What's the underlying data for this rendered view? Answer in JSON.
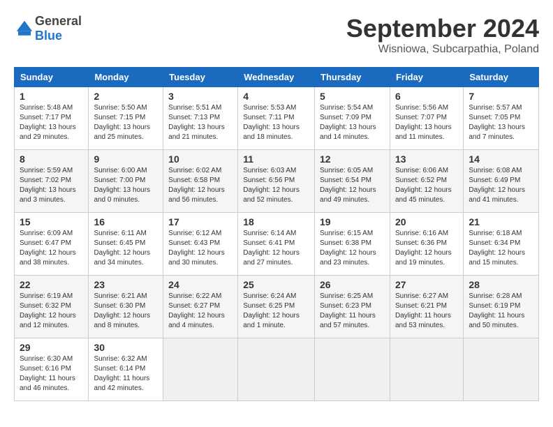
{
  "header": {
    "logo": {
      "general": "General",
      "blue": "Blue"
    },
    "title": "September 2024",
    "subtitle": "Wisniowa, Subcarpathia, Poland"
  },
  "calendar": {
    "columns": [
      "Sunday",
      "Monday",
      "Tuesday",
      "Wednesday",
      "Thursday",
      "Friday",
      "Saturday"
    ],
    "weeks": [
      [
        null,
        {
          "day": "2",
          "info": "Sunrise: 5:50 AM\nSunset: 7:17 PM\nDaylight: 13 hours\nand 25 minutes."
        },
        {
          "day": "3",
          "info": "Sunrise: 5:51 AM\nSunset: 7:13 PM\nDaylight: 13 hours\nand 21 minutes."
        },
        {
          "day": "4",
          "info": "Sunrise: 5:53 AM\nSunset: 7:11 PM\nDaylight: 13 hours\nand 18 minutes."
        },
        {
          "day": "5",
          "info": "Sunrise: 5:54 AM\nSunset: 7:09 PM\nDaylight: 13 hours\nand 14 minutes."
        },
        {
          "day": "6",
          "info": "Sunrise: 5:56 AM\nSunset: 7:07 PM\nDaylight: 13 hours\nand 11 minutes."
        },
        {
          "day": "7",
          "info": "Sunrise: 5:57 AM\nSunset: 7:05 PM\nDaylight: 13 hours\nand 7 minutes."
        }
      ],
      [
        {
          "day": "1",
          "info": "Sunrise: 5:48 AM\nSunset: 7:17 PM\nDaylight: 13 hours\nand 29 minutes."
        },
        {
          "day": "9",
          "info": "Sunrise: 6:00 AM\nSunset: 7:00 PM\nDaylight: 13 hours\nand 0 minutes."
        },
        {
          "day": "10",
          "info": "Sunrise: 6:02 AM\nSunset: 6:58 PM\nDaylight: 12 hours\nand 56 minutes."
        },
        {
          "day": "11",
          "info": "Sunrise: 6:03 AM\nSunset: 6:56 PM\nDaylight: 12 hours\nand 52 minutes."
        },
        {
          "day": "12",
          "info": "Sunrise: 6:05 AM\nSunset: 6:54 PM\nDaylight: 12 hours\nand 49 minutes."
        },
        {
          "day": "13",
          "info": "Sunrise: 6:06 AM\nSunset: 6:52 PM\nDaylight: 12 hours\nand 45 minutes."
        },
        {
          "day": "14",
          "info": "Sunrise: 6:08 AM\nSunset: 6:49 PM\nDaylight: 12 hours\nand 41 minutes."
        }
      ],
      [
        {
          "day": "8",
          "info": "Sunrise: 5:59 AM\nSunset: 7:02 PM\nDaylight: 13 hours\nand 3 minutes."
        },
        {
          "day": "16",
          "info": "Sunrise: 6:11 AM\nSunset: 6:45 PM\nDaylight: 12 hours\nand 34 minutes."
        },
        {
          "day": "17",
          "info": "Sunrise: 6:12 AM\nSunset: 6:43 PM\nDaylight: 12 hours\nand 30 minutes."
        },
        {
          "day": "18",
          "info": "Sunrise: 6:14 AM\nSunset: 6:41 PM\nDaylight: 12 hours\nand 27 minutes."
        },
        {
          "day": "19",
          "info": "Sunrise: 6:15 AM\nSunset: 6:38 PM\nDaylight: 12 hours\nand 23 minutes."
        },
        {
          "day": "20",
          "info": "Sunrise: 6:16 AM\nSunset: 6:36 PM\nDaylight: 12 hours\nand 19 minutes."
        },
        {
          "day": "21",
          "info": "Sunrise: 6:18 AM\nSunset: 6:34 PM\nDaylight: 12 hours\nand 15 minutes."
        }
      ],
      [
        {
          "day": "15",
          "info": "Sunrise: 6:09 AM\nSunset: 6:47 PM\nDaylight: 12 hours\nand 38 minutes."
        },
        {
          "day": "23",
          "info": "Sunrise: 6:21 AM\nSunset: 6:30 PM\nDaylight: 12 hours\nand 8 minutes."
        },
        {
          "day": "24",
          "info": "Sunrise: 6:22 AM\nSunset: 6:27 PM\nDaylight: 12 hours\nand 4 minutes."
        },
        {
          "day": "25",
          "info": "Sunrise: 6:24 AM\nSunset: 6:25 PM\nDaylight: 12 hours\nand 1 minute."
        },
        {
          "day": "26",
          "info": "Sunrise: 6:25 AM\nSunset: 6:23 PM\nDaylight: 11 hours\nand 57 minutes."
        },
        {
          "day": "27",
          "info": "Sunrise: 6:27 AM\nSunset: 6:21 PM\nDaylight: 11 hours\nand 53 minutes."
        },
        {
          "day": "28",
          "info": "Sunrise: 6:28 AM\nSunset: 6:19 PM\nDaylight: 11 hours\nand 50 minutes."
        }
      ],
      [
        {
          "day": "22",
          "info": "Sunrise: 6:19 AM\nSunset: 6:32 PM\nDaylight: 12 hours\nand 12 minutes."
        },
        {
          "day": "30",
          "info": "Sunrise: 6:32 AM\nSunset: 6:14 PM\nDaylight: 11 hours\nand 42 minutes."
        },
        null,
        null,
        null,
        null,
        null
      ],
      [
        {
          "day": "29",
          "info": "Sunrise: 6:30 AM\nSunset: 6:16 PM\nDaylight: 11 hours\nand 46 minutes."
        },
        null,
        null,
        null,
        null,
        null,
        null
      ]
    ]
  }
}
